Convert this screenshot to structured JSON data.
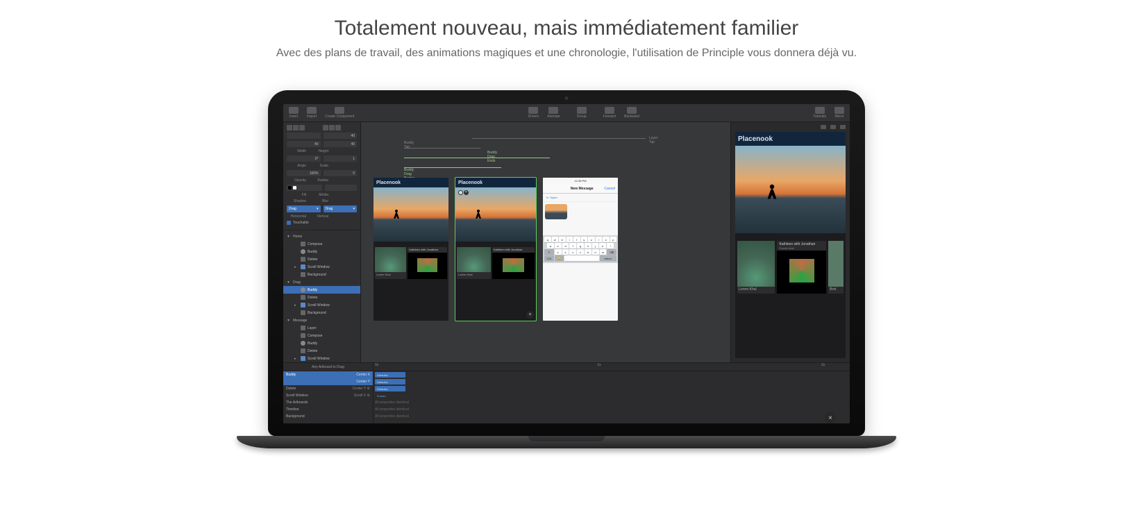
{
  "page": {
    "title": "Totalement nouveau, mais immédiatement familier",
    "subtitle": "Avec des plans de travail, des animations magiques et une chronologie, l'utilisation de Principle vous donnera déjà vu."
  },
  "toolbar": {
    "left": [
      {
        "label": "Insert"
      },
      {
        "label": "Import"
      },
      {
        "label": "Create Component"
      }
    ],
    "center": [
      {
        "label": "Drivers"
      },
      {
        "label": "Animate"
      },
      {
        "label": "Group"
      },
      {
        "label": "Forward"
      },
      {
        "label": "Backward"
      }
    ],
    "right": [
      {
        "label": "Tutorials"
      },
      {
        "label": "Mirror"
      }
    ]
  },
  "inspector": {
    "x": "",
    "y": "40",
    "width": "40",
    "height": "40",
    "angle": "0°",
    "scale": "1",
    "opacity": "100%",
    "radius": "0",
    "shadow_label": "Shadow",
    "blur_label": "Blur",
    "hscroll": "Drag",
    "vscroll": "Drag",
    "h_label": "Horizontal",
    "v_label": "Vertical",
    "touchable": "Touchable",
    "fill_label": "Fill",
    "media_label": "Media",
    "angle_label": "Angle",
    "scale_label": "Scale",
    "opacity_label": "Opacity",
    "radius_label": "Radius",
    "w_label": "Width",
    "h_dim_label": "Height"
  },
  "layers": {
    "groups": [
      {
        "name": "Home",
        "items": [
          "Compose",
          "Buddy",
          "Delete",
          "Scroll Window",
          "Background"
        ]
      },
      {
        "name": "Drag",
        "items": [
          "Buddy",
          "Delete",
          "Scroll Window",
          "Background"
        ],
        "selected": 0
      },
      {
        "name": "Message",
        "items": [
          "Layer",
          "Compose",
          "Buddy",
          "Delete",
          "Scroll Window"
        ]
      }
    ]
  },
  "canvas": {
    "events": [
      {
        "label": "Layer Tap"
      },
      {
        "label": "Buddy Tap"
      },
      {
        "label": "Buddy Drag Ends"
      },
      {
        "label": "Buddy Drag Begins"
      }
    ],
    "artboards": [
      {
        "title": "Placenook",
        "app_header": "Placenook",
        "card1": "Lorem Khal",
        "card2": "Kathleen with Jonathan",
        "card2_sub": "Puzzle time!"
      },
      {
        "title": "Placenook",
        "app_header": "Placenook",
        "selected": true,
        "card1": "Lorem Khal",
        "card2": "Kathleen with Jonathan",
        "card2_sub": "Puzzle time!"
      },
      {
        "title": "",
        "type": "message"
      }
    ],
    "message": {
      "status_time": "12:35 PM",
      "nav_title": "New Message",
      "nav_cancel": "Cancel",
      "to_label": "To:",
      "to_value": "Dylan",
      "kbd_row1": [
        "q",
        "w",
        "e",
        "r",
        "t",
        "y",
        "u",
        "i",
        "o",
        "p"
      ],
      "kbd_row2": [
        "a",
        "s",
        "d",
        "f",
        "g",
        "h",
        "j",
        "k",
        "l"
      ],
      "kbd_row3": [
        "⇧",
        "z",
        "x",
        "c",
        "v",
        "b",
        "n",
        "m",
        "⌫"
      ],
      "kbd_row4": [
        "123",
        "😀",
        "space",
        "return"
      ]
    }
  },
  "preview": {
    "header": "Placenook",
    "card_title": "Kathleen with Jonathan",
    "card_sub": "Puzzle time!",
    "card_left": "Lorem Khal",
    "card_right": "Bret"
  },
  "timeline": {
    "header": "Any Artboard to Drag",
    "ticks": [
      "0s",
      "1s",
      "2s"
    ],
    "rows": [
      {
        "name": "Buddy",
        "prop": "Center X",
        "bar": "Default ▸",
        "selected": true
      },
      {
        "name": "",
        "prop": "Center Y",
        "bar": "Default ▸",
        "selected": true
      },
      {
        "name": "Delete",
        "prop": "Center Y ⚙",
        "bar": "Default ▸"
      },
      {
        "name": "Scroll Window",
        "prop": "Scroll X ⚙",
        "bar": "Frozen",
        "frozen": true
      },
      {
        "name": "The Artboards",
        "prop": "",
        "note": "All properties identical"
      },
      {
        "name": "Timeline",
        "prop": "",
        "note": "All properties identical"
      },
      {
        "name": "Background",
        "prop": "",
        "note": "All properties identical"
      }
    ]
  }
}
